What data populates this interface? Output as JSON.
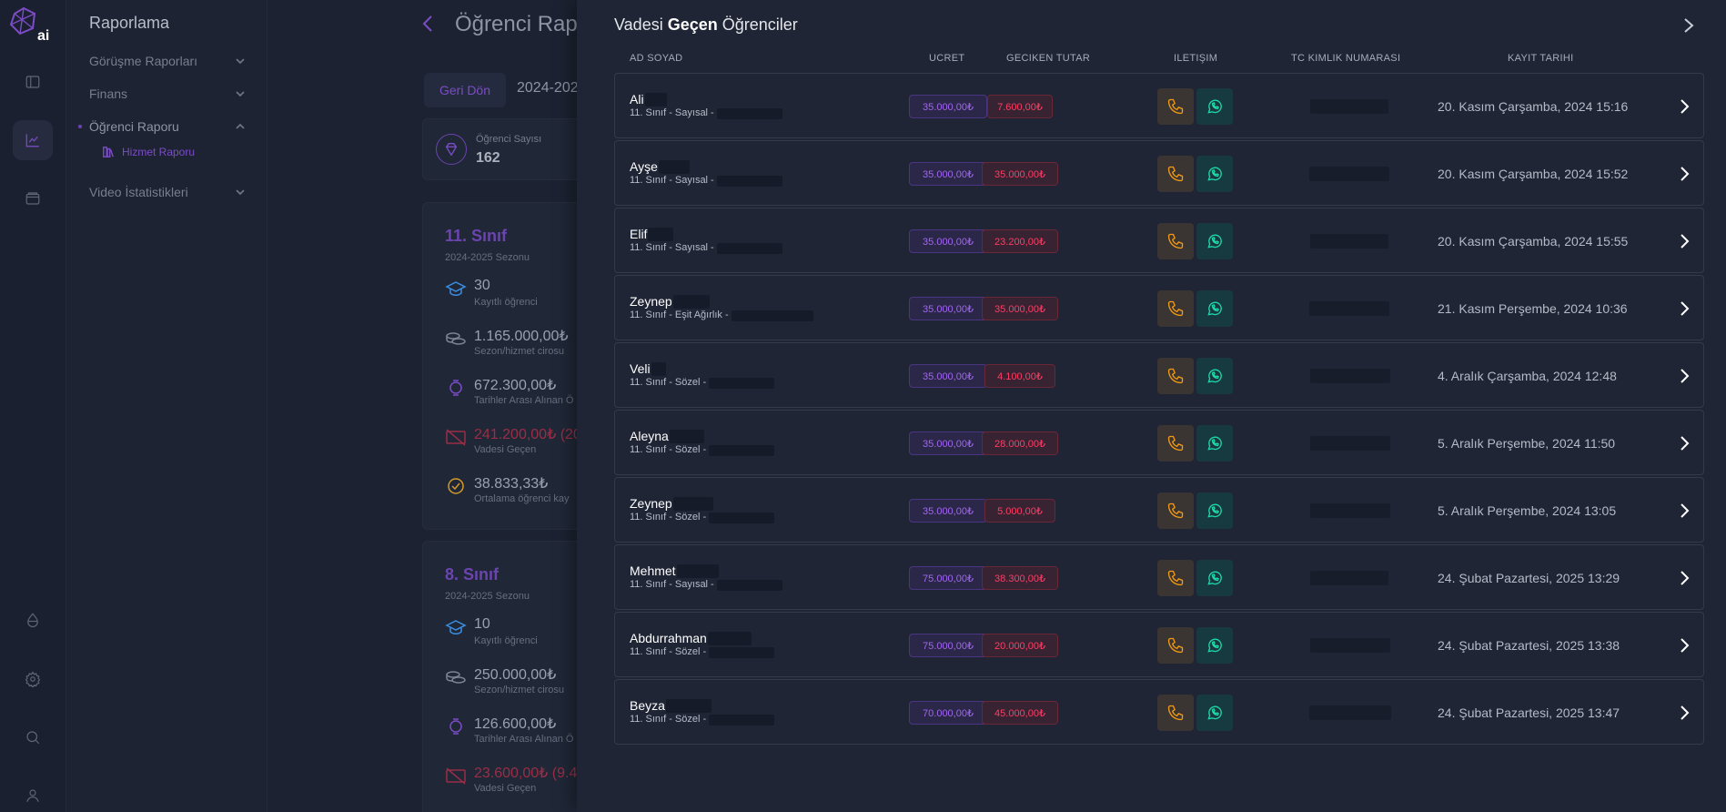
{
  "rail": {
    "logo_text": "ai",
    "icons": [
      "panel-icon",
      "chart-icon",
      "wallet-icon",
      "water-drop-icon",
      "gear-icon",
      "search-icon",
      "user-icon"
    ]
  },
  "sidebar": {
    "title": "Raporlama",
    "items": [
      {
        "label": "Görüşme Raporları"
      },
      {
        "label": "Finans"
      },
      {
        "label": "Öğrenci Raporu"
      },
      {
        "label": "Video İstatistikleri"
      }
    ],
    "sub_item": "Hizmet Raporu"
  },
  "main": {
    "title": "Öğrenci Rap",
    "back_button": "Geri Dön",
    "season": "2024-202",
    "student_count_label": "Öğrenci Sayısı",
    "student_count": "162",
    "cards": [
      {
        "title": "11. Sınıf",
        "season": "2024-2025 Sezonu",
        "stats": [
          {
            "value": "30",
            "label": "Kayıtlı öğrenci"
          },
          {
            "value": "1.165.000,00₺",
            "label": "Sezon/hizmet cirosu"
          },
          {
            "value": "672.300,00₺",
            "label": "Tarihler Arası Alınan Ö"
          },
          {
            "value": "241.200,00₺ (20",
            "label": "Vadesi Geçen"
          },
          {
            "value": "38.833,33₺",
            "label": "Ortalama öğrenci kay"
          }
        ]
      },
      {
        "title": "8. Sınıf",
        "season": "2024-2025 Sezonu",
        "stats": [
          {
            "value": "10",
            "label": "Kayıtlı öğrenci"
          },
          {
            "value": "250.000,00₺",
            "label": "Sezon/hizmet cirosu"
          },
          {
            "value": "126.600,00₺",
            "label": "Tarihler Arası Alınan Ö"
          },
          {
            "value": "23.600,00₺ (9.4",
            "label": "Vadesi Geçen"
          }
        ]
      }
    ]
  },
  "drawer": {
    "title_pre": "Vadesi ",
    "title_bold": "Geçen",
    "title_post": " Öğrenciler",
    "columns": {
      "name": "AD SOYAD",
      "fee": "UCRET",
      "late": "GECIKEN TUTAR",
      "contact": "ILETIŞIM",
      "tc": "TC KIMLIK NUMARASI",
      "date": "KAYIT TARIHI"
    },
    "rows": [
      {
        "name": "Ali",
        "class": "11. Sınıf - Sayısal -",
        "fee": "35.000,00₺",
        "late": "7.600,00₺",
        "date": "20. Kasım Çarşamba, 2024 15:16"
      },
      {
        "name": "Ayşe",
        "class": "11. Sınıf - Sayısal -",
        "fee": "35.000,00₺",
        "late": "35.000,00₺",
        "date": "20. Kasım Çarşamba, 2024 15:52"
      },
      {
        "name": "Elif",
        "class": "11. Sınıf - Sayısal -",
        "fee": "35.000,00₺",
        "late": "23.200,00₺",
        "date": "20. Kasım Çarşamba, 2024 15:55"
      },
      {
        "name": "Zeynep",
        "class": "11. Sınıf - Eşit Ağırlık -",
        "fee": "35.000,00₺",
        "late": "35.000,00₺",
        "date": "21. Kasım Perşembe, 2024 10:36"
      },
      {
        "name": "Veli",
        "class": "11. Sınıf - Sözel -",
        "fee": "35.000,00₺",
        "late": "4.100,00₺",
        "date": "4. Aralık Çarşamba, 2024 12:48"
      },
      {
        "name": "Aleyna",
        "class": "11. Sınıf - Sözel -",
        "fee": "35.000,00₺",
        "late": "28.000,00₺",
        "date": "5. Aralık Perşembe, 2024 11:50"
      },
      {
        "name": "Zeynep",
        "class": "11. Sınıf - Sözel -",
        "fee": "35.000,00₺",
        "late": "5.000,00₺",
        "date": "5. Aralık Perşembe, 2024 13:05"
      },
      {
        "name": "Mehmet",
        "class": "11. Sınıf - Sayısal -",
        "fee": "75.000,00₺",
        "late": "38.300,00₺",
        "date": "24. Şubat Pazartesi, 2025 13:29"
      },
      {
        "name": "Abdurrahman",
        "class": "11. Sınıf - Sözel -",
        "fee": "75.000,00₺",
        "late": "20.000,00₺",
        "date": "24. Şubat Pazartesi, 2025 13:38"
      },
      {
        "name": "Beyza",
        "class": "11. Sınıf - Sözel -",
        "fee": "70.000,00₺",
        "late": "45.000,00₺",
        "date": "24. Şubat Pazartesi, 2025 13:47"
      }
    ]
  },
  "colors": {
    "accent": "#7b4cc6",
    "fee_text": "#a166f0",
    "late_text": "#ff3d63",
    "phone": "#f29a12",
    "whatsapp": "#1fd8a8"
  }
}
